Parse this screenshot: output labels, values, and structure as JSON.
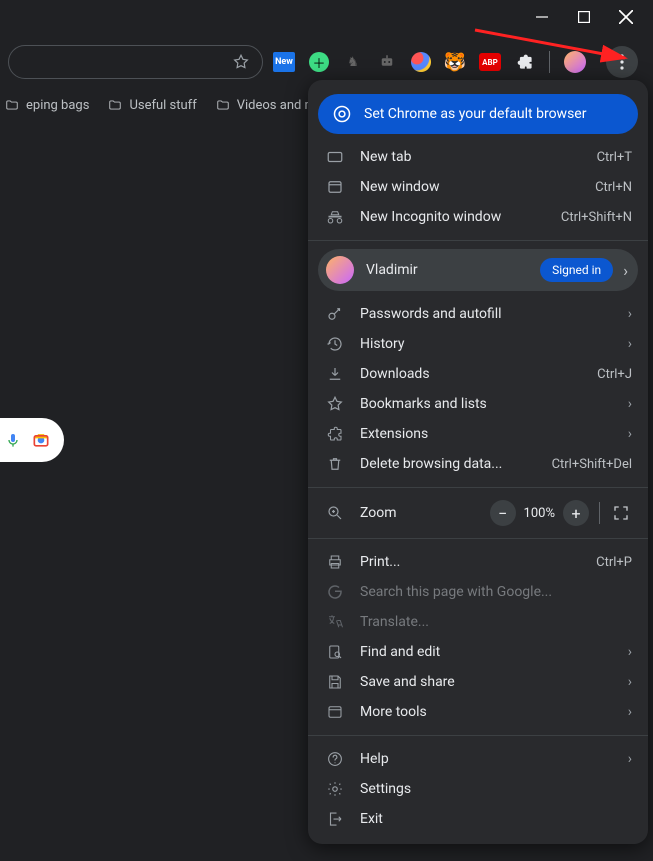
{
  "window": {
    "minimize": "minimize",
    "maximize": "maximize",
    "close": "close"
  },
  "bookmarks": {
    "items": [
      "eping bags",
      "Useful stuff",
      "Videos and music s"
    ]
  },
  "promo": "Set Chrome as your default browser",
  "profile": {
    "name": "Vladimir",
    "status": "Signed in"
  },
  "zoom": {
    "label": "Zoom",
    "value": "100%"
  },
  "menu": {
    "group1": [
      {
        "label": "New tab",
        "shortcut": "Ctrl+T"
      },
      {
        "label": "New window",
        "shortcut": "Ctrl+N"
      },
      {
        "label": "New Incognito window",
        "shortcut": "Ctrl+Shift+N"
      }
    ],
    "group2": [
      {
        "label": "Passwords and autofill",
        "chevron": true
      },
      {
        "label": "History",
        "chevron": true
      },
      {
        "label": "Downloads",
        "shortcut": "Ctrl+J"
      },
      {
        "label": "Bookmarks and lists",
        "chevron": true
      },
      {
        "label": "Extensions",
        "chevron": true
      },
      {
        "label": "Delete browsing data...",
        "shortcut": "Ctrl+Shift+Del"
      }
    ],
    "group3": [
      {
        "label": "Print...",
        "shortcut": "Ctrl+P"
      },
      {
        "label": "Search this page with Google...",
        "disabled": true
      },
      {
        "label": "Translate...",
        "disabled": true
      },
      {
        "label": "Find and edit",
        "chevron": true
      },
      {
        "label": "Save and share",
        "chevron": true
      },
      {
        "label": "More tools",
        "chevron": true
      }
    ],
    "group4": [
      {
        "label": "Help",
        "chevron": true
      },
      {
        "label": "Settings"
      },
      {
        "label": "Exit"
      }
    ]
  }
}
